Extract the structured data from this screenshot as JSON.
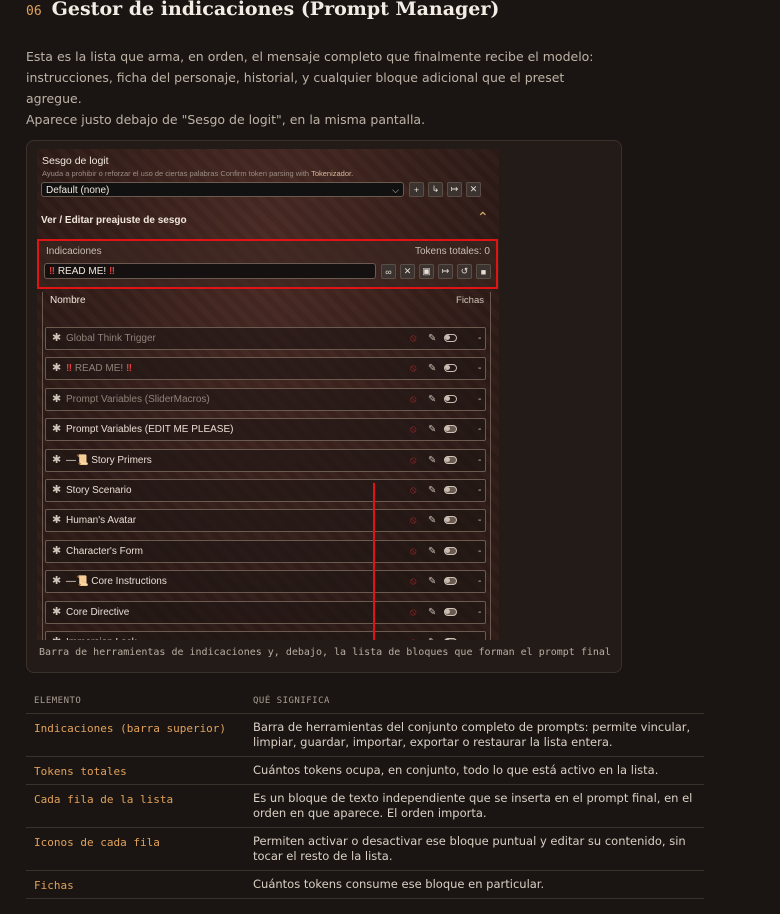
{
  "section": {
    "number": "06",
    "title": "Gestor de indicaciones (Prompt Manager)"
  },
  "intro": {
    "line1": "Esta es la lista que arma, en orden, el mensaje completo que finalmente recibe el modelo:",
    "line2": "instrucciones, ficha del personaje, historial, y cualquier bloque adicional que el preset agregue.",
    "line3": "Aparece justo debajo de \"Sesgo de logit\", en la misma pantalla."
  },
  "screenshot": {
    "logit_bias": {
      "title": "Sesgo de logit",
      "description": "Ayuda a prohibir o reforzar el uso de ciertas palabras",
      "confirm_text": "Confirm token parsing with",
      "tokenizer_link": "Tokenizador.",
      "preset_value": "Default (none)",
      "edit_label": "Ver / Editar preajuste de sesgo"
    },
    "prompts": {
      "label": "Indicaciones",
      "tokens_total": "Tokens totales: 0",
      "selected": "READ ME!",
      "col_name": "Nombre",
      "col_tokens": "Fichas"
    },
    "rows": [
      {
        "name": "Global Think Trigger",
        "dim": true
      },
      {
        "name": "READ ME!",
        "dim": true,
        "excl": true
      },
      {
        "name": "Prompt Variables (SliderMacros)",
        "dim": true
      },
      {
        "name": "Prompt Variables (EDIT ME PLEASE)",
        "dim": false
      },
      {
        "name": "—📜 Story Primers",
        "dim": false
      },
      {
        "name": "Story Scenario",
        "dim": false
      },
      {
        "name": "Human's Avatar",
        "dim": false
      },
      {
        "name": "Character's Form",
        "dim": false
      },
      {
        "name": "—📜 Core Instructions",
        "dim": false
      },
      {
        "name": "Core Directive",
        "dim": false
      },
      {
        "name": "Immersion Lock",
        "dim": false
      }
    ],
    "row_tokens": "-"
  },
  "caption": "Barra de herramientas de indicaciones y, debajo, la lista de bloques que forman el prompt final",
  "table": {
    "headers": [
      "ELEMENTO",
      "QUÉ SIGNIFICA"
    ],
    "rows": [
      {
        "element": "Indicaciones (barra superior)",
        "meaning": "Barra de herramientas del conjunto completo de prompts: permite vincular, limpiar, guardar, importar, exportar o restaurar la lista entera."
      },
      {
        "element": "Tokens totales",
        "meaning": "Cuántos tokens ocupa, en conjunto, todo lo que está activo en la lista."
      },
      {
        "element": "Cada fila de la lista",
        "meaning": "Es un bloque de texto independiente que se inserta en el prompt final, en el orden en que aparece. El orden importa."
      },
      {
        "element": "Iconos de cada fila",
        "meaning": "Permiten activar o desactivar ese bloque puntual y editar su contenido, sin tocar el resto de la lista."
      },
      {
        "element": "Fichas",
        "meaning": "Cuántos tokens consume ese bloque en particular."
      }
    ]
  },
  "colors": {
    "accent": "#e0a15a",
    "highlight_red": "#e01414",
    "background": "#1a1512"
  }
}
